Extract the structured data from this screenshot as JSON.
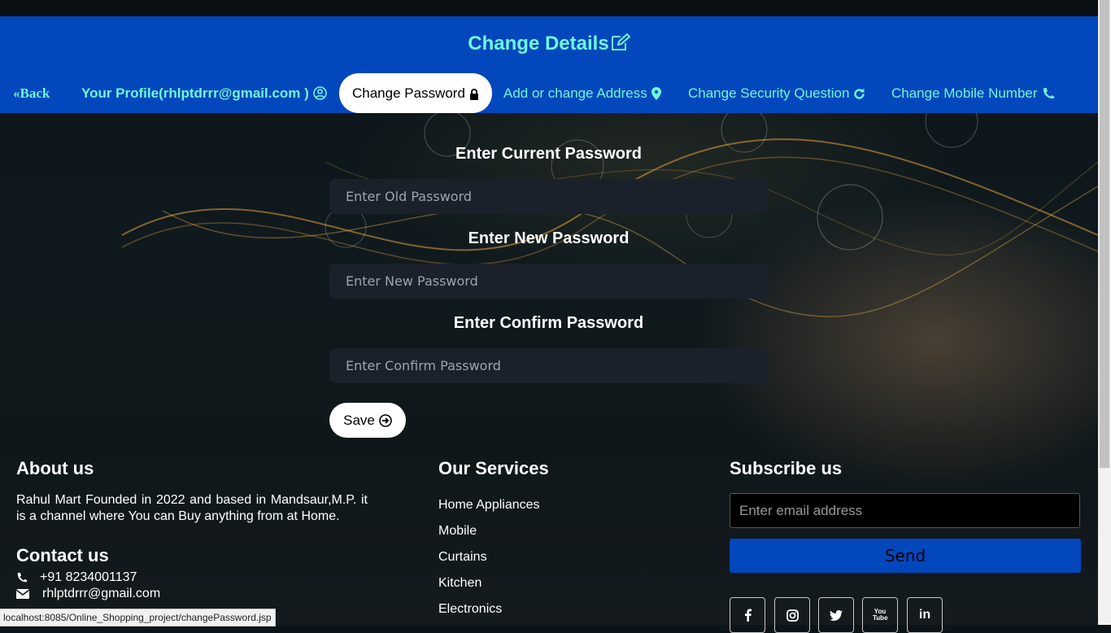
{
  "header": {
    "title": "Change Details",
    "back_label": "Back",
    "nav": [
      {
        "label": "Your Profile(rhlptdrrr@gmail.com )",
        "icon": "user-circle-icon"
      },
      {
        "label": "Change Password",
        "icon": "lock-icon",
        "active": true
      },
      {
        "label": "Add or change Address",
        "icon": "map-marker-icon"
      },
      {
        "label": "Change Security Question",
        "icon": "refresh-icon"
      },
      {
        "label": "Change Mobile Number",
        "icon": "phone-icon"
      }
    ]
  },
  "form": {
    "current_label": "Enter Current Password",
    "current_placeholder": "Enter Old Password",
    "new_label": "Enter New Password",
    "new_placeholder": "Enter New Password",
    "confirm_label": "Enter Confirm Password",
    "confirm_placeholder": "Enter Confirm Password",
    "save_label": "Save"
  },
  "footer": {
    "about_title": "About us",
    "about_text": "Rahul Mart Founded in 2022 and based in Mandsaur,M.P. it is a channel where You can Buy anything from at Home.",
    "contact_title": "Contact us",
    "phone": "+91 8234001137",
    "email": "rhlptdrrr@gmail.com",
    "services_title": "Our Services",
    "services": [
      "Home Appliances",
      "Mobile",
      "Curtains",
      "Kitchen",
      "Electronics"
    ],
    "subscribe_title": "Subscribe us",
    "subscribe_placeholder": "Enter email address",
    "send_label": "Send",
    "social": [
      "facebook-icon",
      "instagram-icon",
      "twitter-icon",
      "youtube-icon",
      "linkedin-icon"
    ],
    "youtube_text": "You Tube",
    "linkedin_text": "in"
  },
  "status_bar": {
    "url": "localhost:8085/Online_Shopping_project/changePassword.jsp"
  },
  "colors": {
    "header_bg": "#0347bd",
    "accent_text": "#6ff7d9",
    "input_bg": "#1b212b"
  }
}
